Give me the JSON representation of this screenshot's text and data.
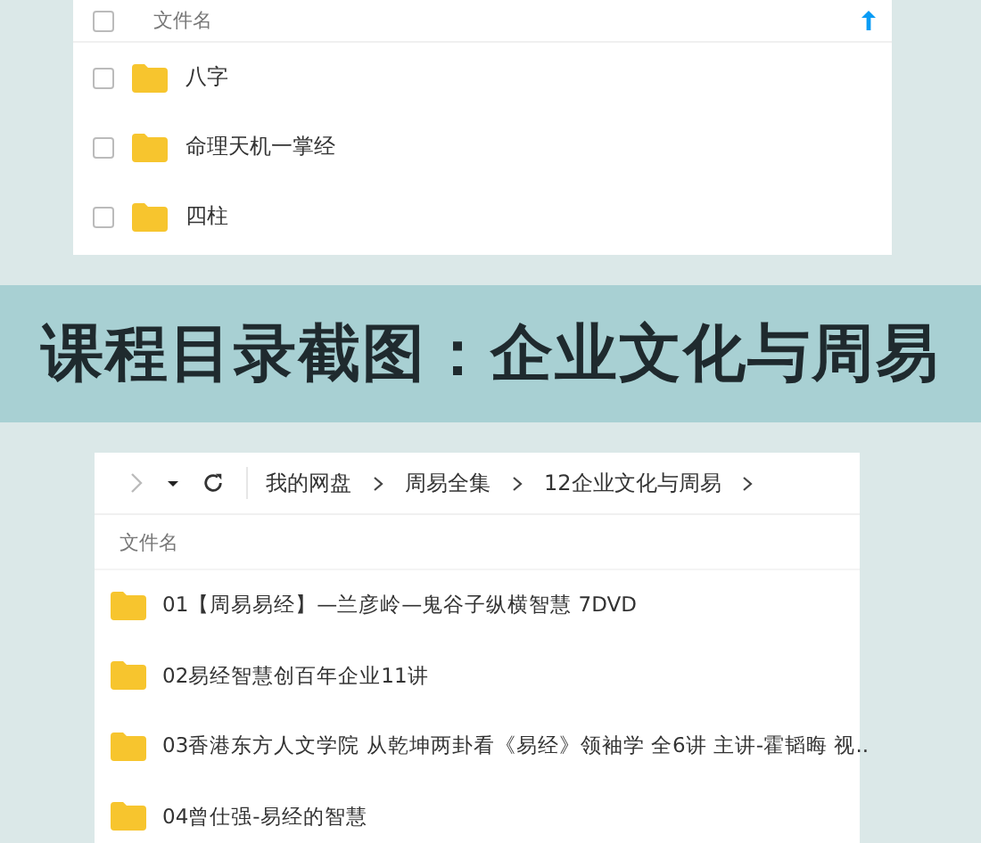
{
  "top_panel": {
    "header": {
      "label": "文件名",
      "checked": false
    },
    "rows": [
      {
        "name": "八字",
        "checked": false
      },
      {
        "name": "命理天机一掌经",
        "checked": false
      },
      {
        "name": "四柱",
        "checked": false
      }
    ]
  },
  "banner": {
    "title": "课程目录截图：企业文化与周易"
  },
  "bottom_panel": {
    "breadcrumb": [
      "我的网盘",
      "周易全集",
      "12企业文化与周易"
    ],
    "header": {
      "label": "文件名"
    },
    "rows": [
      {
        "name": "01【周易易经】—兰彦岭—鬼谷子纵横智慧 7DVD"
      },
      {
        "name": "02易经智慧创百年企业11讲"
      },
      {
        "name": "03香港东方人文学院 从乾坤两卦看《易经》领袖学 全6讲 主讲-霍韬晦 视.."
      },
      {
        "name": "04曾仕强-易经的智慧"
      }
    ]
  }
}
